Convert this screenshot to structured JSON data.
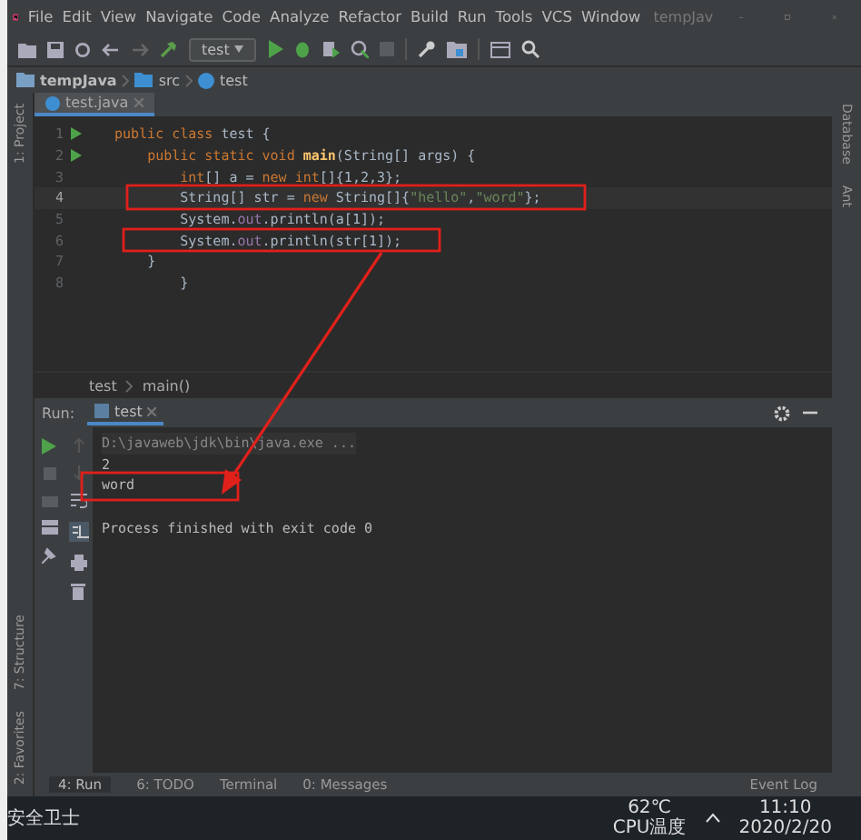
{
  "window": {
    "title": "tempJav"
  },
  "menu": [
    "File",
    "Edit",
    "View",
    "Navigate",
    "Code",
    "Analyze",
    "Refactor",
    "Build",
    "Run",
    "Tools",
    "VCS",
    "Window"
  ],
  "run_config": {
    "label": "test"
  },
  "breadcrumb": [
    "tempJava",
    "src",
    "test"
  ],
  "editor_tabs": [
    {
      "label": "test.java",
      "selected": true
    }
  ],
  "code_lines": [
    {
      "number": "1",
      "run": true,
      "current": false,
      "segments": [
        {
          "kind": "keyword",
          "text": "public class "
        },
        {
          "kind": "plain",
          "text": "test {"
        }
      ]
    },
    {
      "number": "2",
      "run": true,
      "current": false,
      "segments": [
        {
          "kind": "keyword",
          "text": "    public static void "
        },
        {
          "kind": "method",
          "text": "main"
        },
        {
          "kind": "plain",
          "text": "(String[] args) {"
        }
      ]
    },
    {
      "number": "3",
      "run": false,
      "current": false,
      "segments": [
        {
          "kind": "keyword",
          "text": "        int"
        },
        {
          "kind": "plain",
          "text": "[] a = "
        },
        {
          "kind": "keyword",
          "text": "new int"
        },
        {
          "kind": "plain",
          "text": "[]{1,2,3};"
        }
      ]
    },
    {
      "number": "4",
      "run": false,
      "current": true,
      "segments": [
        {
          "kind": "plain",
          "text": "        String[] str = "
        },
        {
          "kind": "keyword",
          "text": "new "
        },
        {
          "kind": "plain",
          "text": "String[]{"
        },
        {
          "kind": "string",
          "text": "\"hello\""
        },
        {
          "kind": "plain",
          "text": ","
        },
        {
          "kind": "string",
          "text": "\"word\""
        },
        {
          "kind": "plain",
          "text": "};"
        }
      ]
    },
    {
      "number": "5",
      "run": false,
      "current": false,
      "segments": [
        {
          "kind": "plain",
          "text": "        System."
        },
        {
          "kind": "field",
          "text": "out"
        },
        {
          "kind": "plain",
          "text": ".println(a[1]);"
        }
      ]
    },
    {
      "number": "6",
      "run": false,
      "current": false,
      "segments": [
        {
          "kind": "plain",
          "text": "        System."
        },
        {
          "kind": "field",
          "text": "out"
        },
        {
          "kind": "plain",
          "text": ".println(str[1]);"
        }
      ]
    },
    {
      "number": "7",
      "run": false,
      "current": false,
      "segments": [
        {
          "kind": "plain",
          "text": "    }"
        }
      ]
    },
    {
      "number": "8",
      "run": false,
      "current": false,
      "segments": [
        {
          "kind": "plain",
          "text": "        }"
        }
      ]
    }
  ],
  "editor_breadcrumb": [
    "test",
    "main()"
  ],
  "run_panel": {
    "label": "Run:",
    "tabs": [
      {
        "label": "test",
        "selected": true
      }
    ],
    "output": [
      {
        "kind": "command",
        "text": "D:\\javaweb\\jdk\\bin\\java.exe ..."
      },
      {
        "kind": "plain",
        "text": "2"
      },
      {
        "kind": "plain",
        "text": "word"
      },
      {
        "kind": "spaced",
        "text": "Process finished with exit code 0"
      }
    ]
  },
  "left_strip": {
    "top": [
      "1: Project"
    ],
    "bottom": [
      "7: Structure",
      "2: Favorites"
    ]
  },
  "right_strip": [
    "Database",
    "Ant"
  ],
  "tool_tabs": [
    {
      "label": "4: Run",
      "selected": true
    },
    {
      "label": "6: TODO",
      "selected": false
    },
    {
      "label": "Terminal",
      "selected": false
    },
    {
      "label": "0: Messages",
      "selected": false
    }
  ],
  "event_log": "Event Log",
  "taskbar": {
    "app": "安全卫士",
    "cpu_temp": "62℃",
    "cpu_label": "CPU温度",
    "time": "11:10",
    "date": "2020/2/20"
  }
}
